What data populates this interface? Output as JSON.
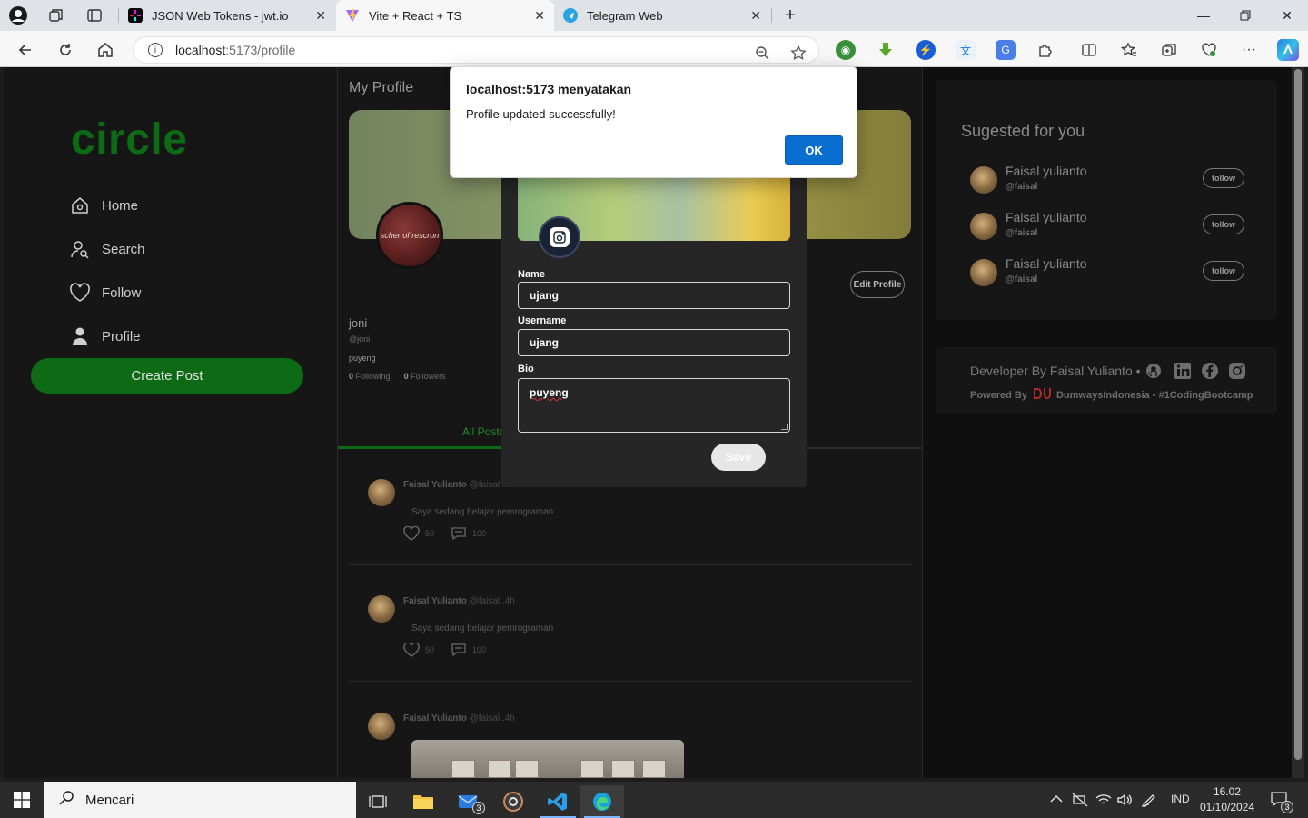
{
  "browser": {
    "tabs": [
      {
        "title": "JSON Web Tokens - jwt.io",
        "icon": "jwt-icon"
      },
      {
        "title": "Vite + React + TS",
        "icon": "vite-icon",
        "active": true
      },
      {
        "title": "Telegram Web",
        "icon": "telegram-icon"
      }
    ],
    "url_host": "localhost",
    "url_path": ":5173/profile"
  },
  "alert": {
    "title": "localhost:5173 menyatakan",
    "message": "Profile updated successfully!",
    "ok_label": "OK"
  },
  "sidebar": {
    "logo": "circle",
    "items": [
      {
        "label": "Home",
        "icon": "home-icon"
      },
      {
        "label": "Search",
        "icon": "search-user-icon"
      },
      {
        "label": "Follow",
        "icon": "heart-icon"
      },
      {
        "label": "Profile",
        "icon": "person-icon"
      }
    ],
    "create_post_label": "Create Post"
  },
  "profile": {
    "page_title": "My Profile",
    "avatar_text": "scher of rescron",
    "edit_label": "Edit Profile",
    "name": "joni",
    "username": "@joni",
    "bio": "puyeng",
    "following_count": "0",
    "following_label": "Following",
    "followers_count": "0",
    "followers_label": "Followers",
    "tab_label": "All Posts"
  },
  "posts": [
    {
      "author": "Faisal Yulianto",
      "meta": "@faisal .4h",
      "text": "Saya sedang belajar pemrograman",
      "likes": "50",
      "comments": "100"
    },
    {
      "author": "Faisal Yulianto",
      "meta": "@faisal .4h",
      "text": "Saya sedang belajar pemrograman",
      "likes": "50",
      "comments": "100"
    },
    {
      "author": "Faisal Yulianto",
      "meta": "@faisal .4h"
    }
  ],
  "edit_modal": {
    "name_label": "Name",
    "name_value": "ujang",
    "username_label": "Username",
    "username_value": "ujang",
    "bio_label": "Bio",
    "bio_value": "puyeng",
    "save_label": "Save"
  },
  "suggested": {
    "title": "Sugested for you",
    "users": [
      {
        "name": "Faisal yulianto",
        "handle": "@faisal",
        "button": "follow"
      },
      {
        "name": "Faisal yulianto",
        "handle": "@faisal",
        "button": "follow"
      },
      {
        "name": "Faisal yulianto",
        "handle": "@faisal",
        "button": "follow"
      }
    ]
  },
  "developer": {
    "line1": "Developer By Faisal Yulianto •",
    "powered_by": "Powered By",
    "brand": "DumwaysIndonesia • #1CodingBootcamp"
  },
  "taskbar": {
    "search_placeholder": "Mencari",
    "mail_badge": "3",
    "language": "IND",
    "time": "16.02",
    "date": "01/10/2024",
    "notification_count": "3"
  }
}
